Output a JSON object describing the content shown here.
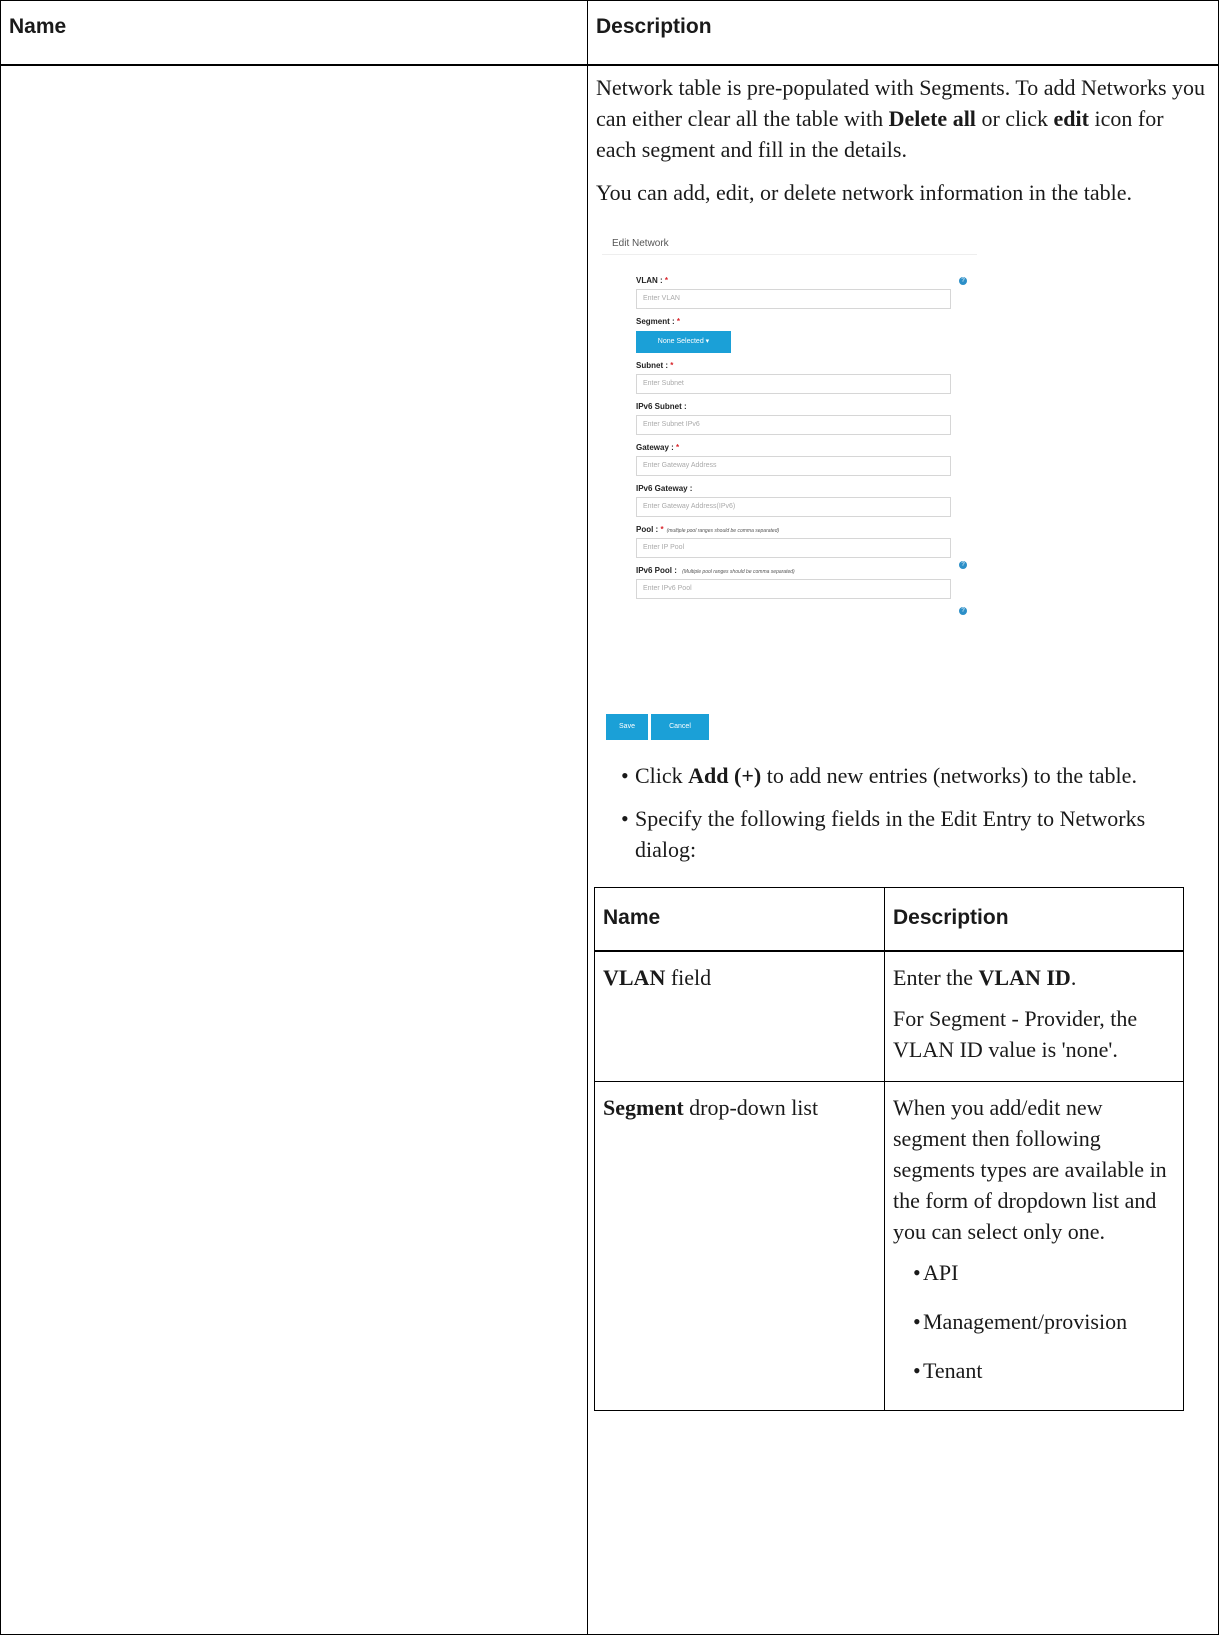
{
  "header": {
    "name": "Name",
    "description": "Description"
  },
  "intro": {
    "p1_a": "Network table is pre-populated with Segments. To add Networks you can either clear all the table with ",
    "p1_b": "Delete all",
    "p1_c": " or click ",
    "p1_d": "edit",
    "p1_e": " icon for each segment and fill in the details.",
    "p2": "You can add, edit, or delete network information in the table."
  },
  "dialog": {
    "title": "Edit Network",
    "vlan_label": "VLAN : ",
    "vlan_placeholder": "Enter VLAN",
    "segment_label": "Segment : ",
    "segment_button": "None Selected ▾",
    "subnet_label": "Subnet : ",
    "subnet_placeholder": "Enter Subnet",
    "ipv6_subnet_label": "IPv6 Subnet :",
    "ipv6_subnet_placeholder": "Enter Subnet IPv6",
    "gateway_label": "Gateway : ",
    "gateway_placeholder": "Enter Gateway Address",
    "ipv6_gateway_label": "IPv6 Gateway :",
    "ipv6_gateway_placeholder": "Enter Gateway Address(IPv6)",
    "pool_label": "Pool : ",
    "pool_hint": "(multiple pool ranges should be comma separated)",
    "pool_placeholder": "Enter IP Pool",
    "ipv6_pool_label": "IPv6 Pool : ",
    "ipv6_pool_hint": "(Multiple pool ranges should be comma separated)",
    "ipv6_pool_placeholder": "Enter IPv6 Pool",
    "required_mark": "*",
    "save": "Save",
    "cancel": "Cancel"
  },
  "bullets": {
    "b1_a": "Click ",
    "b1_b": "Add (+)",
    "b1_c": " to add new entries (networks) to the table.",
    "b2": "Specify the following fields in the Edit Entry to Networks dialog:"
  },
  "inner_table": {
    "header_name": "Name",
    "header_description": "Description",
    "vlan_name_bold": "VLAN",
    "vlan_name_rest": " field",
    "vlan_desc_a": "Enter the ",
    "vlan_desc_b": "VLAN ID",
    "vlan_desc_c": ".",
    "vlan_desc_p2": "For Segment - Provider, the VLAN ID value is 'none'.",
    "segment_name_bold": "Segment",
    "segment_name_rest": " drop-down list",
    "segment_desc": "When you add/edit new segment then following segments types are available in the form of dropdown list and you can select only one.",
    "segment_types": [
      "API",
      "Management/provision",
      "Tenant"
    ]
  }
}
